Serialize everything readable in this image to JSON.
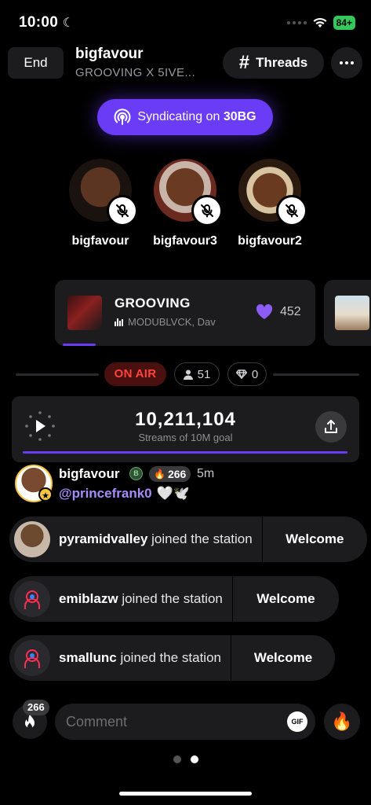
{
  "status_bar": {
    "time": "10:00",
    "battery": "84+"
  },
  "header": {
    "end_label": "End",
    "host_name": "bigfavour",
    "station_subtitle": "GROOVING X 5IVE...",
    "threads_label": "Threads"
  },
  "syndicating": {
    "prefix": "Syndicating on",
    "target": "30BG"
  },
  "speakers": [
    {
      "name": "bigfavour",
      "muted": true
    },
    {
      "name": "bigfavour3",
      "muted": true
    },
    {
      "name": "bigfavour2",
      "muted": true
    }
  ],
  "now_playing": {
    "title": "GROOVING",
    "artist": "MODUBLVCK, Dav",
    "likes": "452"
  },
  "stats": {
    "on_air_label": "ON AIR",
    "listeners": "51",
    "gems": "0"
  },
  "streams": {
    "count": "10,211,104",
    "label": "Streams of 10M goal",
    "progress": 1.0
  },
  "message": {
    "user": "bigfavour",
    "fire_count": "266",
    "time": "5m",
    "mention": "@princefrank0",
    "emojis": "🤍🕊️"
  },
  "joins": [
    {
      "user": "pyramidvalley",
      "text": "joined the station",
      "action": "Welcome"
    },
    {
      "user": "emiblazw",
      "text": "joined the station",
      "action": "Welcome"
    },
    {
      "user": "smallunc",
      "text": "joined the station",
      "action": "Welcome"
    }
  ],
  "composer": {
    "fire_count": "266",
    "placeholder": "Comment",
    "gif_label": "GIF",
    "reaction": "🔥"
  },
  "colors": {
    "accent": "#6a3cf5",
    "on_air_red": "#ff453a",
    "success": "#34c759",
    "gold": "#f5c542"
  }
}
